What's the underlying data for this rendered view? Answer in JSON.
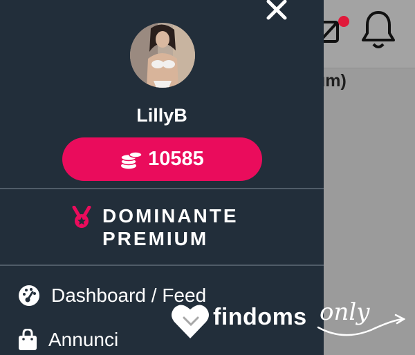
{
  "background_page": {
    "partial_text": "um)",
    "notification_dot_color": "#e0193a"
  },
  "drawer": {
    "close_label": "✕",
    "username": "LillyB",
    "coins": {
      "value": "10585",
      "icon": "coins-stack-icon",
      "color": "#ea0c5c"
    },
    "rank": {
      "icon": "medal-icon",
      "line1": "DOMINANTE",
      "line2": "PREMIUM",
      "icon_color": "#ea0c5c"
    },
    "menu": [
      {
        "label": "Dashboard / Feed",
        "icon": "speedometer-icon"
      },
      {
        "label": "Annunci",
        "icon": "shopping-bag-icon"
      }
    ],
    "background_color": "#222e3a"
  },
  "watermark": {
    "brand": "findoms",
    "script": "only",
    "logo": "heart-tag-icon"
  }
}
